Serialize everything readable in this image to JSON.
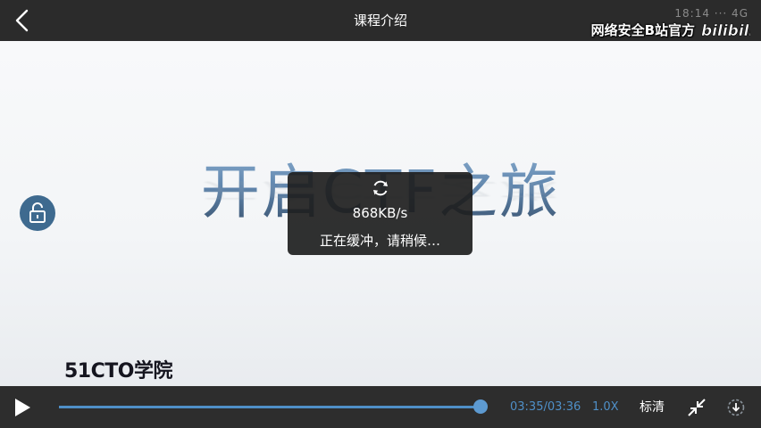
{
  "header": {
    "title": "课程介绍",
    "back_icon": "chevron-left-icon",
    "status_ghost": "18:14 ··· 4G"
  },
  "watermark": {
    "text": "网络安全B站官方",
    "logo_text": "bilibili"
  },
  "hero": {
    "title": "开启CTF之旅"
  },
  "lock": {
    "icon": "lock-open-icon"
  },
  "buffering": {
    "icon": "refresh-icon",
    "speed": "868KB/s",
    "message": "正在缓冲，请稍候…"
  },
  "brand": {
    "logo_text": "51CTO学院"
  },
  "player": {
    "play_icon": "play-icon",
    "progress": 0.995,
    "time": "03:35/03:36",
    "speed": "1.0X",
    "quality": "标清",
    "shrink_icon": "exit-fullscreen-icon",
    "download_icon": "download-icon",
    "colors": {
      "accent": "#4f8fc7",
      "bar": "#2d2d2d",
      "lock": "#3e6a8f"
    }
  }
}
